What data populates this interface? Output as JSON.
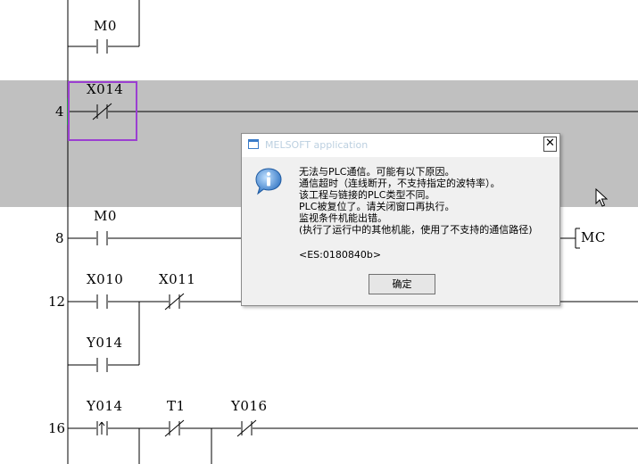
{
  "ladder": {
    "steps": {
      "s4": "4",
      "s8": "8",
      "s12": "12",
      "s16": "16"
    },
    "devices": {
      "m0_top": "M0",
      "x014": "X014",
      "m0": "M0",
      "x010": "X010",
      "x011": "X011",
      "y014_a": "Y014",
      "y014_b": "Y014",
      "t1": "T1",
      "y016": "Y016"
    },
    "coil_mc": "MC"
  },
  "dialog": {
    "title": "MELSOFT application",
    "close_label": "✕",
    "message": "无法与PLC通信。可能有以下原因。\n通信超时（连线断开，不支持指定的波特率）。\n该工程与链接的PLC类型不同。\nPLC被复位了。请关闭窗口再执行。\n监视条件机能出错。\n(执行了运行中的其他机能，使用了不支持的通信路径)",
    "error_code": "<ES:0180840b>",
    "ok_label": "确定"
  },
  "colors": {
    "selection_band": "#c0c0c0",
    "cursor_box": "#9b3fd1",
    "power_rail_highlight": "#2e9e3e"
  }
}
